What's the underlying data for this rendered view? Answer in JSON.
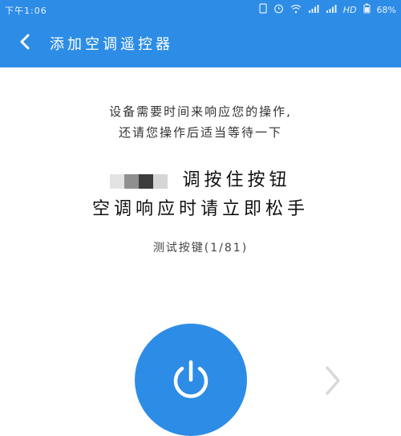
{
  "status_bar": {
    "time": "下午1:06",
    "network": "HD",
    "battery": "68%",
    "icons": [
      "sim-icon",
      "alarm-icon",
      "wifi-icon",
      "signal-icon",
      "signal-icon",
      "battery-icon"
    ]
  },
  "app_bar": {
    "title": "添加空调遥控器",
    "back_icon": "chevron-left-icon"
  },
  "instructions": {
    "line1": "设备需要时间来响应您的操作,",
    "line2": "还请您操作后适当等待一下"
  },
  "prompt": {
    "line1_suffix": "调按住按钮",
    "line2": "空调响应时请立即松手"
  },
  "counter": "测试按键(1/81)",
  "power_button": {
    "icon": "power-icon"
  },
  "next_button": {
    "icon": "chevron-right-icon"
  },
  "colors": {
    "primary": "#2d8ce6",
    "background": "#ffffff",
    "next_arrow": "#d8d8d8"
  }
}
